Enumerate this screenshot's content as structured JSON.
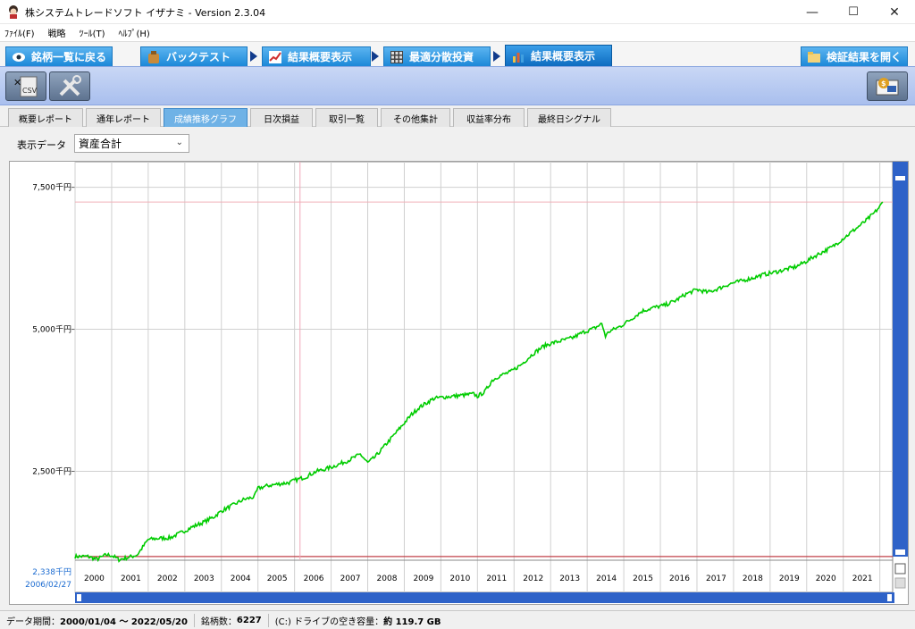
{
  "window": {
    "title": "株システムトレードソフト イザナミ - Version 2.3.04",
    "min_glyph": "—",
    "max_glyph": "☐",
    "close_glyph": "✕"
  },
  "menu": [
    "ﾌｧｲﾙ(F)",
    "戦略",
    "ﾂｰﾙ(T)",
    "ﾍﾙﾌﾟ(H)"
  ],
  "nav": {
    "back_label": "銘柄一覧に戻る",
    "backtest_label": "バックテスト",
    "summary_label": "結果概要表示",
    "optimize_label": "最適分散投資",
    "summary2_label": "結果概要表示",
    "open_label": "検証結果を開く"
  },
  "toolbar": {
    "csv_label": "CSV"
  },
  "subtabs": [
    "概要レポート",
    "通年レポート",
    "成績推移グラフ",
    "日次損益",
    "取引一覧",
    "その他集計",
    "収益率分布",
    "最終日シグナル"
  ],
  "active_subtab": "成績推移グラフ",
  "display_data": {
    "label": "表示データ",
    "selected": "資産合計"
  },
  "chart_data": {
    "type": "line",
    "y_unit": "千円",
    "ylim": [
      935,
      7950
    ],
    "yticks": [
      {
        "value": 7500,
        "label": "7,500千円"
      },
      {
        "value": 5000,
        "label": "5,000千円"
      },
      {
        "value": 2500,
        "label": "2,500千円"
      }
    ],
    "x_years": [
      "2000",
      "2001",
      "2002",
      "2003",
      "2004",
      "2005",
      "2006",
      "2007",
      "2008",
      "2009",
      "2010",
      "2011",
      "2012",
      "2013",
      "2014",
      "2015",
      "2016",
      "2017",
      "2018",
      "2019",
      "2020",
      "2021"
    ],
    "cursor": {
      "value_label": "2,338千円",
      "date_label": "2006/02/27"
    },
    "max_line_value": 7240,
    "base_line_value": 1000,
    "series_color": "#00cc00",
    "series": [
      {
        "x": [
          2000.0,
          2000.35,
          2000.6,
          2000.85,
          2001.0,
          2001.2,
          2001.4,
          2001.55,
          2001.7,
          2002.0,
          2002.3,
          2002.6,
          2002.9,
          2003.2,
          2003.5,
          2003.8,
          2004.0,
          2004.3,
          2004.6,
          2004.9,
          2005.0,
          2005.3,
          2005.6,
          2005.85,
          2006.0,
          2006.3,
          2006.6,
          2006.9,
          2007.2,
          2007.5,
          2007.8,
          2008.0,
          2008.2,
          2008.4,
          2008.6,
          2008.8,
          2009.0,
          2009.2,
          2009.4,
          2009.6,
          2009.8,
          2010.0,
          2010.3,
          2010.6,
          2010.9,
          2011.0,
          2011.2,
          2011.4,
          2011.6,
          2011.9,
          2012.2,
          2012.5,
          2012.8,
          2013.0,
          2013.3,
          2013.6,
          2013.9,
          2014.2,
          2014.4,
          2014.5,
          2014.6,
          2014.9,
          2015.2,
          2015.5,
          2015.8,
          2016.1,
          2016.4,
          2016.7,
          2017.0,
          2017.3,
          2017.6,
          2017.9,
          2018.2,
          2018.5,
          2018.8,
          2019.1,
          2019.4,
          2019.7,
          2020.0,
          2020.2,
          2020.4,
          2020.7,
          2021.0,
          2021.3,
          2021.6,
          2021.85,
          2022.0,
          2022.08
        ],
        "y": [
          1000,
          1000,
          950,
          1030,
          1020,
          945,
          975,
          1000,
          1030,
          1300,
          1320,
          1330,
          1420,
          1520,
          1600,
          1700,
          1800,
          1900,
          2000,
          2050,
          2200,
          2250,
          2280,
          2300,
          2340,
          2400,
          2500,
          2550,
          2620,
          2700,
          2800,
          2650,
          2750,
          2900,
          3050,
          3200,
          3350,
          3500,
          3620,
          3700,
          3780,
          3800,
          3820,
          3840,
          3860,
          3820,
          3900,
          4100,
          4180,
          4250,
          4380,
          4560,
          4700,
          4750,
          4800,
          4850,
          4950,
          5020,
          5100,
          4880,
          4960,
          5050,
          5180,
          5320,
          5380,
          5420,
          5500,
          5620,
          5700,
          5650,
          5720,
          5800,
          5850,
          5900,
          5960,
          6000,
          6050,
          6100,
          6200,
          6280,
          6350,
          6450,
          6600,
          6750,
          6900,
          7050,
          7160,
          7240
        ]
      }
    ]
  },
  "status": {
    "period_label": "データ期間：",
    "period_value": "2000/01/04 ～ 2022/05/20",
    "count_label": "銘柄数：",
    "count_value": "6227",
    "disk_label": "(C:) ドライブの空き容量：",
    "disk_value": "約 119.7 GB"
  }
}
